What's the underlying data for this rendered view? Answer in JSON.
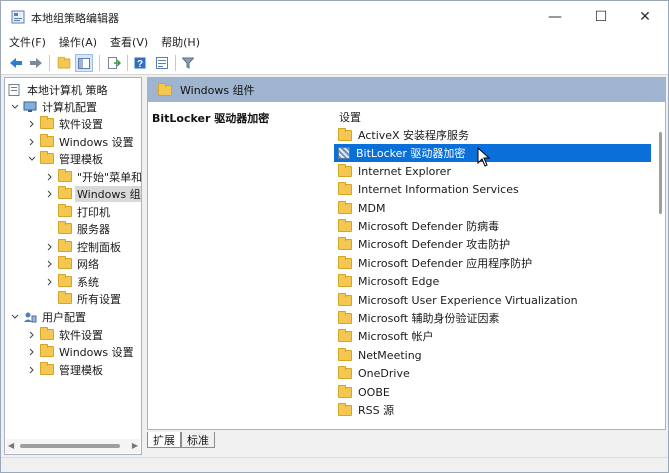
{
  "window": {
    "title": "本地组策略编辑器",
    "controls": {
      "minimize": "—",
      "maximize": "☐",
      "close": "✕"
    }
  },
  "menubar": {
    "items": [
      "文件(F)",
      "操作(A)",
      "查看(V)",
      "帮助(H)"
    ]
  },
  "toolbar": {
    "buttons": [
      "back-icon",
      "forward-icon",
      "up-folder-icon",
      "show-hide-tree-icon",
      "export-list-icon",
      "help-icon",
      "properties-icon",
      "filter-icon"
    ]
  },
  "tree": {
    "root": "本地计算机 策略",
    "computer_config": "计算机配置",
    "cc_software": "软件设置",
    "cc_windows": "Windows 设置",
    "cc_admin": "管理模板",
    "start_menu": "\"开始\"菜单和",
    "windows_components": "Windows 组件",
    "printers": "打印机",
    "servers": "服务器",
    "control_panel": "控制面板",
    "network": "网络",
    "system": "系统",
    "all_settings": "所有设置",
    "user_config": "用户配置",
    "uc_software": "软件设置",
    "uc_windows": "Windows 设置",
    "uc_admin": "管理模板"
  },
  "right": {
    "header": "Windows 组件",
    "desc_title": "BitLocker 驱动器加密",
    "column_header": "设置",
    "items": [
      "ActiveX 安装程序服务",
      "BitLocker 驱动器加密",
      "Internet Explorer",
      "Internet Information Services",
      "MDM",
      "Microsoft Defender 防病毒",
      "Microsoft Defender 攻击防护",
      "Microsoft Defender 应用程序防护",
      "Microsoft Edge",
      "Microsoft User Experience Virtualization",
      "Microsoft 辅助身份验证因素",
      "Microsoft 帐户",
      "NetMeeting",
      "OneDrive",
      "OOBE",
      "RSS 源"
    ],
    "selected_index": 1
  },
  "tabs": [
    "扩展",
    "标准"
  ],
  "colors": {
    "selection": "#0a6fd8",
    "header_band": "#9fb4cf",
    "folder": "#f3c752"
  }
}
